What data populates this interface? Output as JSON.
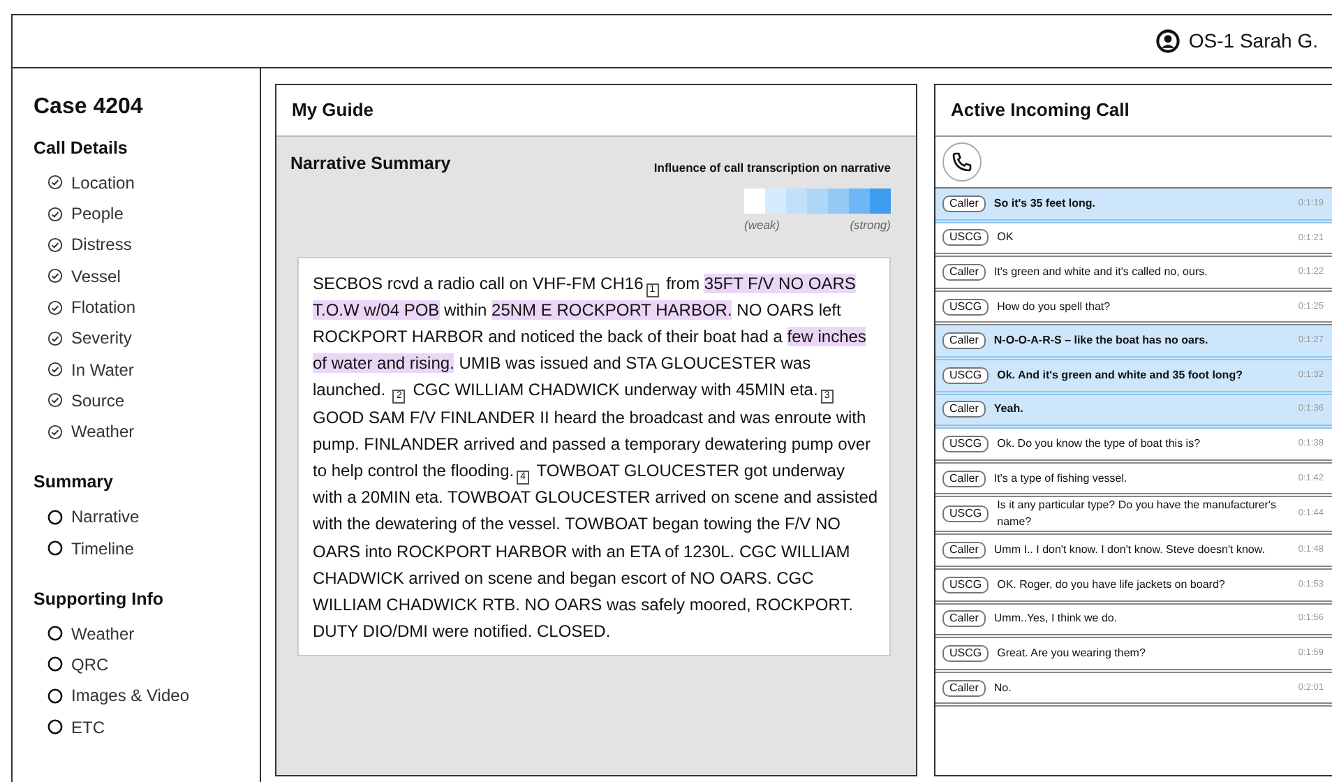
{
  "user": {
    "name": "OS-1 Sarah G."
  },
  "sidebar": {
    "title": "Case 4204",
    "sections": [
      {
        "title": "Call Details",
        "items": [
          {
            "label": "Location",
            "checked": true
          },
          {
            "label": "People",
            "checked": true
          },
          {
            "label": "Distress",
            "checked": true
          },
          {
            "label": "Vessel",
            "checked": true
          },
          {
            "label": "Flotation",
            "checked": true
          },
          {
            "label": "Severity",
            "checked": true
          },
          {
            "label": "In Water",
            "checked": true
          },
          {
            "label": "Source",
            "checked": true
          },
          {
            "label": "Weather",
            "checked": true
          }
        ]
      },
      {
        "title": "Summary",
        "items": [
          {
            "label": "Narrative",
            "checked": false
          },
          {
            "label": "Timeline",
            "checked": false
          }
        ]
      },
      {
        "title": "Supporting Info",
        "items": [
          {
            "label": "Weather",
            "checked": false
          },
          {
            "label": "QRC",
            "checked": false
          },
          {
            "label": "Images & Video",
            "checked": false
          },
          {
            "label": "ETC",
            "checked": false
          }
        ]
      }
    ]
  },
  "guide": {
    "title": "My Guide",
    "section_title": "Narrative Summary",
    "legend": {
      "title": "Influence of call transcription on narrative",
      "low_label": "(weak)",
      "high_label": "(strong)",
      "swatches": [
        {
          "color": "#ffffff"
        },
        {
          "color": "#d6ebfc"
        },
        {
          "color": "#c2e0fa"
        },
        {
          "color": "#aed6f8"
        },
        {
          "color": "#94c9f6"
        },
        {
          "color": "#6fb6f4"
        },
        {
          "color": "#3d9cf0"
        }
      ]
    },
    "narrative": [
      {
        "kind": "text",
        "text": "SECBOS rcvd a radio call on VHF-FM CH16"
      },
      {
        "kind": "marker",
        "text": "1"
      },
      {
        "kind": "text",
        "text": " from "
      },
      {
        "kind": "highlight",
        "text": "35FT F/V NO OARS T.O.W w/04 POB"
      },
      {
        "kind": "text",
        "text": " within "
      },
      {
        "kind": "highlight",
        "text": "25NM E ROCKPORT HARBOR."
      },
      {
        "kind": "text",
        "text": " NO OARS left ROCKPORT HARBOR and noticed the back of their boat had a "
      },
      {
        "kind": "highlight",
        "text": "few inches of water and rising."
      },
      {
        "kind": "text",
        "text": " UMIB was issued and STA GLOUCESTER was launched. "
      },
      {
        "kind": "marker",
        "text": "2"
      },
      {
        "kind": "text",
        "text": " CGC WILLIAM CHADWICK underway with 45MIN eta."
      },
      {
        "kind": "marker",
        "text": "3"
      },
      {
        "kind": "text",
        "text": " GOOD SAM F/V FINLANDER II heard the broadcast and was enroute with pump. FINLANDER arrived and passed a temporary dewatering pump over to help control the flooding."
      },
      {
        "kind": "marker",
        "text": "4"
      },
      {
        "kind": "text",
        "text": " TOWBOAT GLOUCESTER got underway with a 20MIN eta. TOWBOAT GLOUCESTER arrived on scene and assisted with the dewatering of the vessel. TOWBOAT began towing the F/V NO OARS into ROCKPORT HARBOR with an ETA of 1230L. CGC WILLIAM CHADWICK arrived on scene and began escort of NO OARS. CGC WILLIAM CHADWICK RTB. NO OARS was safely moored, ROCKPORT. DUTY DIO/DMI were notified. CLOSED."
      }
    ]
  },
  "call": {
    "title": "Active Incoming Call",
    "transcript": [
      {
        "speaker": "Caller",
        "text": "So it's 35 feet long.",
        "time": "0:1:19",
        "highlighted": true
      },
      {
        "speaker": "USCG",
        "text": "OK",
        "time": "0:1:21",
        "highlighted": false
      },
      {
        "speaker": "Caller",
        "text": "It's green and white and it's called no, ours.",
        "time": "0:1:22",
        "highlighted": false
      },
      {
        "speaker": "USCG",
        "text": "How do you spell that?",
        "time": "0:1:25",
        "highlighted": false
      },
      {
        "speaker": "Caller",
        "text": "N-O-O-A-R-S – like the boat has no oars.",
        "time": "0:1:27",
        "highlighted": true
      },
      {
        "speaker": "USCG",
        "text": "Ok. And it's green and white and 35 foot long?",
        "time": "0:1:32",
        "highlighted": true
      },
      {
        "speaker": "Caller",
        "text": "Yeah.",
        "time": "0:1:36",
        "highlighted": true
      },
      {
        "speaker": "USCG",
        "text": "Ok. Do you know the type of boat this is?",
        "time": "0:1:38",
        "highlighted": false
      },
      {
        "speaker": "Caller",
        "text": "It's a type of fishing vessel.",
        "time": "0:1:42",
        "highlighted": false
      },
      {
        "speaker": "USCG",
        "text": "Is it any particular type? Do you have the manufacturer's name?",
        "time": "0:1:44",
        "highlighted": false
      },
      {
        "speaker": "Caller",
        "text": "Umm I.. I don't know. I don't know. Steve doesn't know.",
        "time": "0:1:48",
        "highlighted": false
      },
      {
        "speaker": "USCG",
        "text": "OK. Roger, do you have life jackets on board?",
        "time": "0:1:53",
        "highlighted": false
      },
      {
        "speaker": "Caller",
        "text": "Umm..Yes, I think we do.",
        "time": "0:1:56",
        "highlighted": false
      },
      {
        "speaker": "USCG",
        "text": "Great. Are you wearing them?",
        "time": "0:1:59",
        "highlighted": false
      },
      {
        "speaker": "Caller",
        "text": "No.",
        "time": "0:2:01",
        "highlighted": false
      }
    ]
  }
}
